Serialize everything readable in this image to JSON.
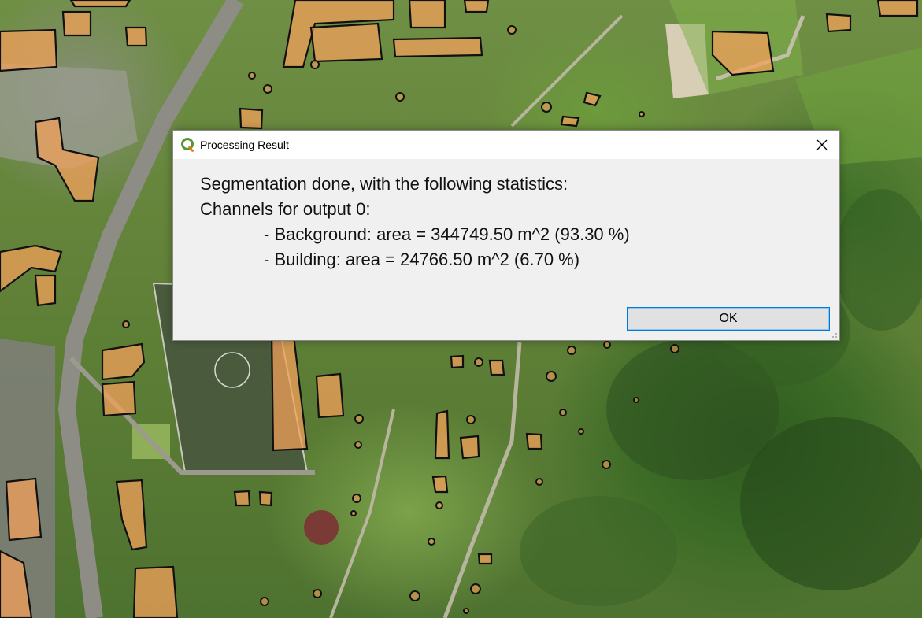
{
  "dialog": {
    "title": "Processing Result",
    "close_label": "×",
    "lines": [
      "Segmentation done, with the following statistics:",
      "Channels for output 0:"
    ],
    "stats": [
      "- Background: area = 344749.50 m^2 (93.30 %)",
      "- Building: area = 24766.50 m^2 (6.70 %)"
    ],
    "ok_label": "OK",
    "accent": "#0078d7",
    "app_icon": "qgis-logo-icon"
  },
  "map": {
    "segment_fill": "#f2a05a",
    "segment_outline": "#111111"
  }
}
